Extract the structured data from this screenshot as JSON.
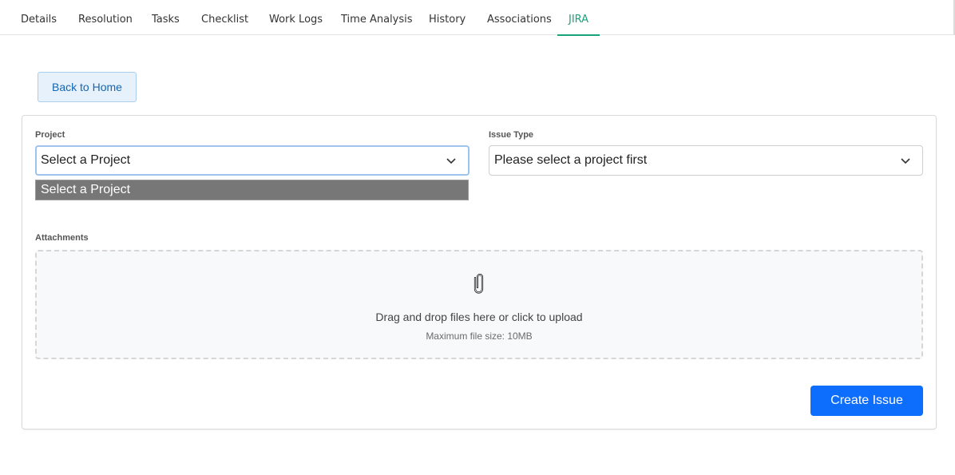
{
  "tabs": [
    {
      "label": "Details",
      "active": false
    },
    {
      "label": "Resolution",
      "active": false
    },
    {
      "label": "Tasks",
      "active": false
    },
    {
      "label": "Checklist",
      "active": false
    },
    {
      "label": "Work Logs",
      "active": false
    },
    {
      "label": "Time Analysis",
      "active": false
    },
    {
      "label": "History",
      "active": false
    },
    {
      "label": "Associations",
      "active": false
    },
    {
      "label": "JIRA",
      "active": true
    }
  ],
  "back_button": {
    "label": "Back to Home"
  },
  "form": {
    "project": {
      "label": "Project",
      "value": "Select a Project",
      "dropdown_open": true,
      "options": [
        "Select a Project"
      ],
      "highlighted_option": "Select a Project"
    },
    "issue_type": {
      "label": "Issue Type",
      "value": "Please select a project first"
    },
    "attachments": {
      "label": "Attachments",
      "icon": "paperclip-icon",
      "prompt": "Drag and drop files here or click to upload",
      "max_size": "Maximum file size: 10MB"
    },
    "submit_label": "Create Issue"
  },
  "colors": {
    "accent_tab": "#1aa37a",
    "primary_button": "#0d6efd",
    "back_button_bg": "#e6f1fb",
    "back_button_text": "#1566b1",
    "option_highlight": "#777777"
  }
}
